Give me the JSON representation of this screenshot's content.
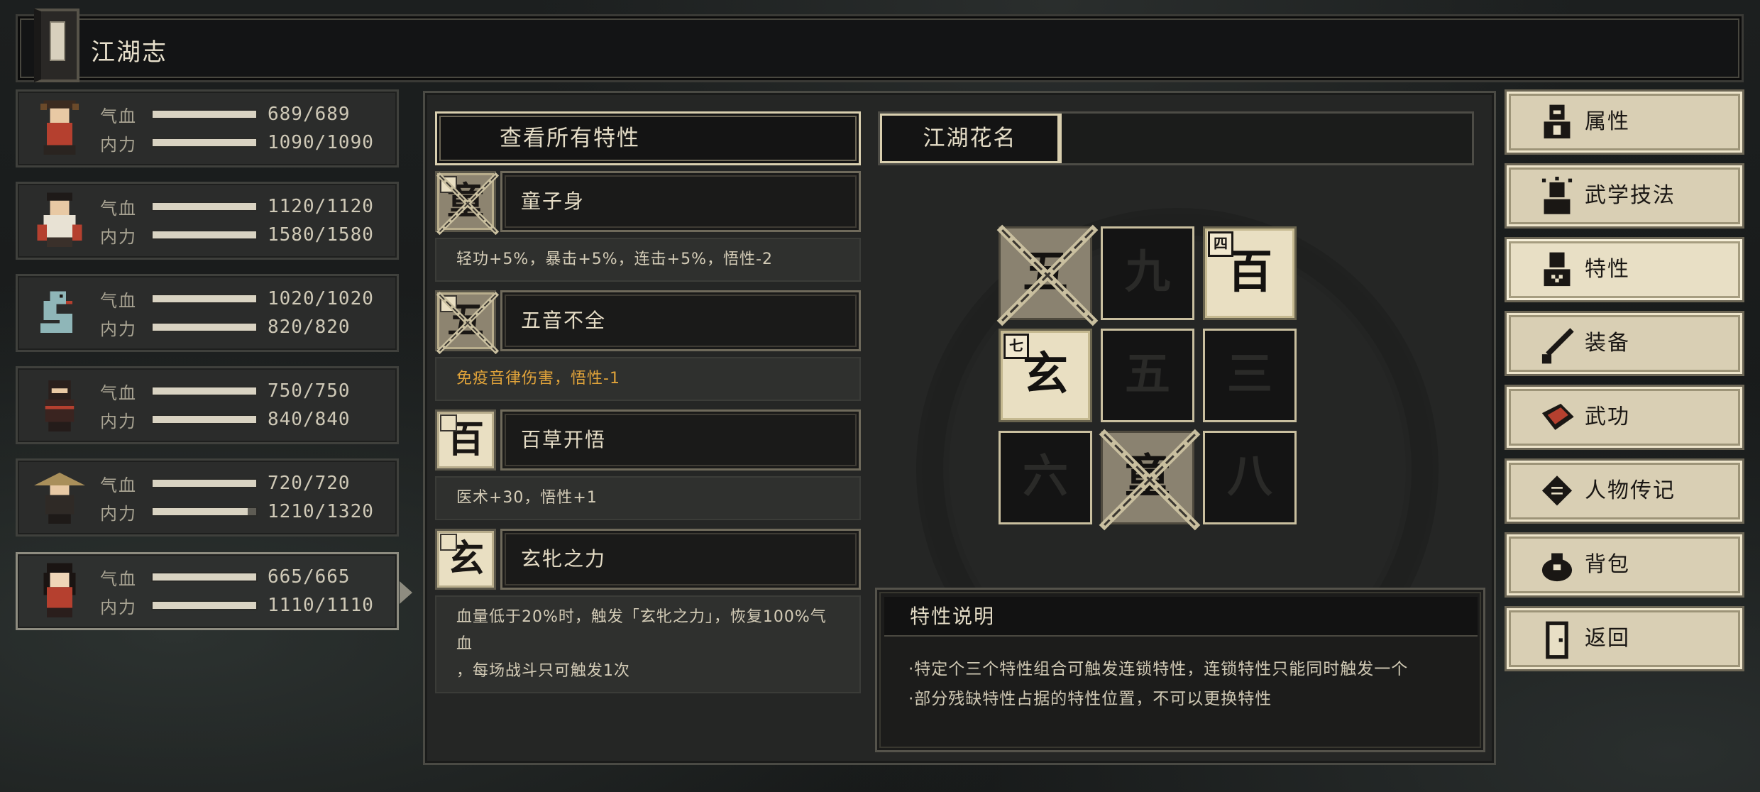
{
  "window": {
    "title": "江湖志"
  },
  "party": [
    {
      "hp_label": "气血",
      "hp_text": "689/689",
      "hp": 1.0,
      "mp_label": "内力",
      "mp_text": "1090/1090",
      "mp": 1.0,
      "portrait": "elder-portrait"
    },
    {
      "hp_label": "气血",
      "hp_text": "1120/1120",
      "hp": 1.0,
      "mp_label": "内力",
      "mp_text": "1580/1580",
      "mp": 1.0,
      "portrait": "swordsman-portrait"
    },
    {
      "hp_label": "气血",
      "hp_text": "1020/1020",
      "hp": 1.0,
      "mp_label": "内力",
      "mp_text": "820/820",
      "mp": 1.0,
      "portrait": "serpent-portrait"
    },
    {
      "hp_label": "气血",
      "hp_text": "750/750",
      "hp": 1.0,
      "mp_label": "内力",
      "mp_text": "840/840",
      "mp": 1.0,
      "portrait": "ninja-portrait"
    },
    {
      "hp_label": "气血",
      "hp_text": "720/720",
      "hp": 1.0,
      "mp_label": "内力",
      "mp_text": "1210/1320",
      "mp": 0.917,
      "portrait": "straw-hat-portrait"
    },
    {
      "hp_label": "气血",
      "hp_text": "665/665",
      "hp": 1.0,
      "mp_label": "内力",
      "mp_text": "1110/1110",
      "mp": 1.0,
      "portrait": "female-portrait"
    }
  ],
  "traits_panel": {
    "view_all_label": "查看所有特性",
    "traits": [
      {
        "glyph": "童",
        "name": "童子身",
        "desc": "轻功+5%，暴击+5%，连击+5%，悟性-2",
        "broken": true
      },
      {
        "glyph": "五",
        "name": "五音不全",
        "desc": "免疫音律伤害，悟性-1",
        "broken": true
      },
      {
        "glyph": "百",
        "name": "百草开悟",
        "desc": "医术+30，悟性+1",
        "broken": false
      },
      {
        "glyph": "玄",
        "name": "玄牝之力",
        "desc_line1": "血量低于20%时，触发「玄牝之力」，恢复100%气血",
        "desc_line2": "，每场战斗只可触发1次",
        "broken": false
      }
    ]
  },
  "name_panel": {
    "tab_label": "江湖花名"
  },
  "grid": {
    "cells": [
      {
        "glyph": "五",
        "state": "broken",
        "badge": ""
      },
      {
        "glyph": "九",
        "state": "empty",
        "badge": ""
      },
      {
        "glyph": "百",
        "state": "active",
        "badge": "四"
      },
      {
        "glyph": "玄",
        "state": "active",
        "badge": "七"
      },
      {
        "glyph": "五",
        "state": "empty",
        "badge": ""
      },
      {
        "glyph": "三",
        "state": "empty",
        "badge": ""
      },
      {
        "glyph": "六",
        "state": "empty",
        "badge": ""
      },
      {
        "glyph": "童",
        "state": "broken",
        "badge": ""
      },
      {
        "glyph": "八",
        "state": "empty",
        "badge": ""
      }
    ]
  },
  "description": {
    "title": "特性说明",
    "line1": "·特定个三个特性组合可触发连锁特性，连锁特性只能同时触发一个",
    "line2": "·部分残缺特性占据的特性位置，不可以更换特性"
  },
  "menu": [
    {
      "label": "属性",
      "icon": "attributes-icon"
    },
    {
      "label": "武学技法",
      "icon": "martial-skills-icon"
    },
    {
      "label": "特性",
      "icon": "traits-icon",
      "selected": true
    },
    {
      "label": "装备",
      "icon": "sword-icon"
    },
    {
      "label": "武功",
      "icon": "book-icon"
    },
    {
      "label": "人物传记",
      "icon": "scroll-icon"
    },
    {
      "label": "背包",
      "icon": "bag-icon"
    },
    {
      "label": "返回",
      "icon": "door-icon"
    }
  ]
}
